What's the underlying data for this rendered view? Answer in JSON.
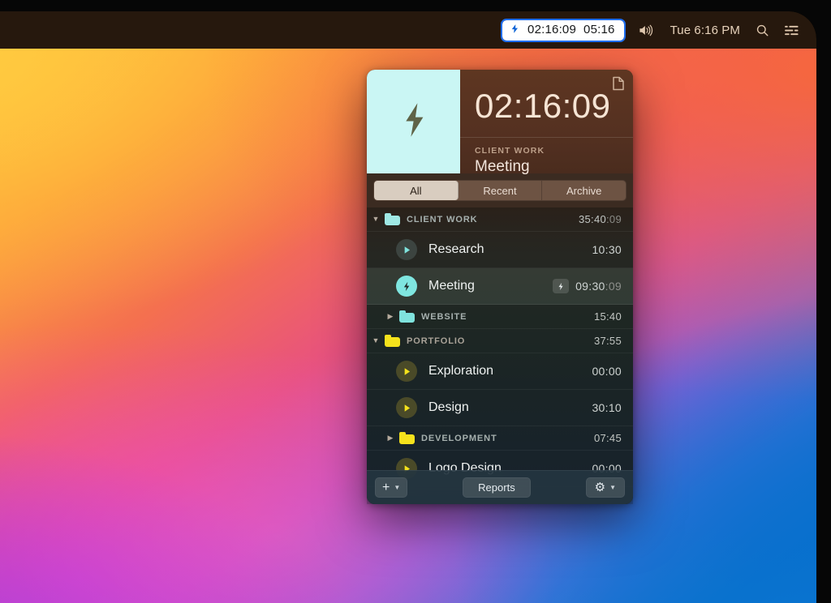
{
  "menubar": {
    "timer_pill": {
      "icon": "bolt-icon",
      "elapsed": "02:16:09",
      "remaining": "05:16"
    },
    "volume_icon": "volume-icon",
    "clock": "Tue 6:16 PM",
    "search_icon": "search-icon",
    "control_center_icon": "control-center-icon"
  },
  "panel": {
    "header": {
      "thumbnail_icon": "bolt-icon",
      "thumbnail_bg": "#caf6f4",
      "note_icon": "document-icon",
      "timer": "02:16:09",
      "category": "CLIENT WORK",
      "task": "Meeting"
    },
    "tabs": [
      {
        "label": "All",
        "active": true
      },
      {
        "label": "Recent",
        "active": false
      },
      {
        "label": "Archive",
        "active": false
      }
    ],
    "rows": [
      {
        "kind": "folder",
        "label": "CLIENT WORK",
        "expanded": true,
        "indent": 0,
        "color": "#9fe8e4",
        "time": "35:40",
        "seconds": ":09"
      },
      {
        "kind": "task",
        "label": "Research",
        "indent": 1,
        "icon": "play-icon",
        "icon_color": "#7fe3dd",
        "icon_bg": "#3c4440",
        "time": "10:30",
        "seconds": "",
        "active": false,
        "running": false
      },
      {
        "kind": "task",
        "label": "Meeting",
        "indent": 1,
        "icon": "bolt-icon",
        "icon_color": "#1f2a27",
        "icon_bg": "#7fe6e0",
        "time": "09:30",
        "seconds": ":09",
        "active": true,
        "running": true
      },
      {
        "kind": "folder",
        "label": "WEBSITE",
        "expanded": false,
        "indent": 1,
        "color": "#7fe3dd",
        "time": "15:40",
        "seconds": ""
      },
      {
        "kind": "folder",
        "label": "PORTFOLIO",
        "expanded": true,
        "indent": 0,
        "color": "#f5e21c",
        "time": "37:55",
        "seconds": ""
      },
      {
        "kind": "task",
        "label": "Exploration",
        "indent": 1,
        "icon": "play-icon",
        "icon_color": "#f5e21c",
        "icon_bg": "#4a4a28",
        "time": "00:00",
        "seconds": "",
        "active": false,
        "running": false
      },
      {
        "kind": "task",
        "label": "Design",
        "indent": 1,
        "icon": "play-icon",
        "icon_color": "#f5e21c",
        "icon_bg": "#4a4a28",
        "time": "30:10",
        "seconds": "",
        "active": false,
        "running": false
      },
      {
        "kind": "folder",
        "label": "DEVELOPMENT",
        "expanded": false,
        "indent": 1,
        "color": "#f5e21c",
        "time": "07:45",
        "seconds": ""
      },
      {
        "kind": "task",
        "label": "Logo Design",
        "indent": 1,
        "icon": "play-icon",
        "icon_color": "#f5e21c",
        "icon_bg": "#4a4a28",
        "time": "00:00",
        "seconds": "",
        "active": false,
        "running": false
      }
    ],
    "toolbar": {
      "add_label": "",
      "add_icon": "plus-icon",
      "reports_label": "Reports",
      "settings_icon": "gear-icon",
      "chevron_icon": "chevron-down-icon"
    }
  }
}
